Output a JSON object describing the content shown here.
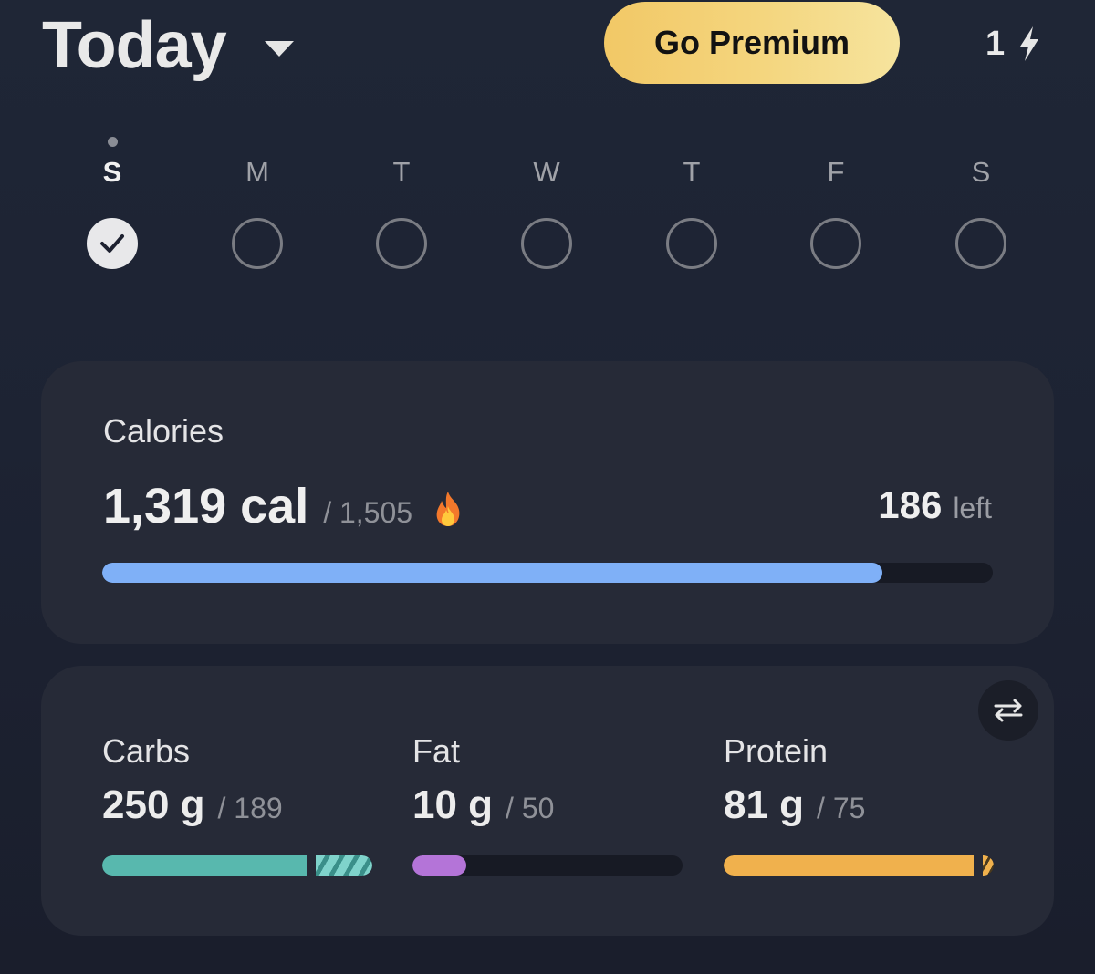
{
  "header": {
    "title": "Today",
    "premium_label": "Go Premium",
    "streak_count": "1",
    "streak_icon": "bolt-icon",
    "premium_color_start": "#f2c866",
    "premium_color_end": "#f6e49e"
  },
  "week": {
    "days": [
      {
        "letter": "S",
        "checked": true,
        "today": true
      },
      {
        "letter": "M",
        "checked": false,
        "today": false
      },
      {
        "letter": "T",
        "checked": false,
        "today": false
      },
      {
        "letter": "W",
        "checked": false,
        "today": false
      },
      {
        "letter": "T",
        "checked": false,
        "today": false
      },
      {
        "letter": "F",
        "checked": false,
        "today": false
      },
      {
        "letter": "S",
        "checked": false,
        "today": false
      }
    ]
  },
  "calories": {
    "label": "Calories",
    "consumed": "1,319 cal",
    "goal": "/ 1,505",
    "left_value": "186",
    "left_label": "left",
    "consumed_number": 1319,
    "goal_number": 1505,
    "icon": "fire-icon",
    "bar_color": "#7fb0f7"
  },
  "macros": {
    "swap_icon": "swap-arrows-icon",
    "items": [
      {
        "key": "carbs",
        "name": "Carbs",
        "value": "250 g",
        "goal": "/ 189",
        "value_number": 250,
        "goal_number": 189,
        "color": "#58b8ae"
      },
      {
        "key": "fat",
        "name": "Fat",
        "value": "10 g",
        "goal": "/ 50",
        "value_number": 10,
        "goal_number": 50,
        "color": "#b474d8"
      },
      {
        "key": "protein",
        "name": "Protein",
        "value": "81 g",
        "goal": "/ 75",
        "value_number": 81,
        "goal_number": 75,
        "color": "#f0b14d"
      }
    ]
  }
}
